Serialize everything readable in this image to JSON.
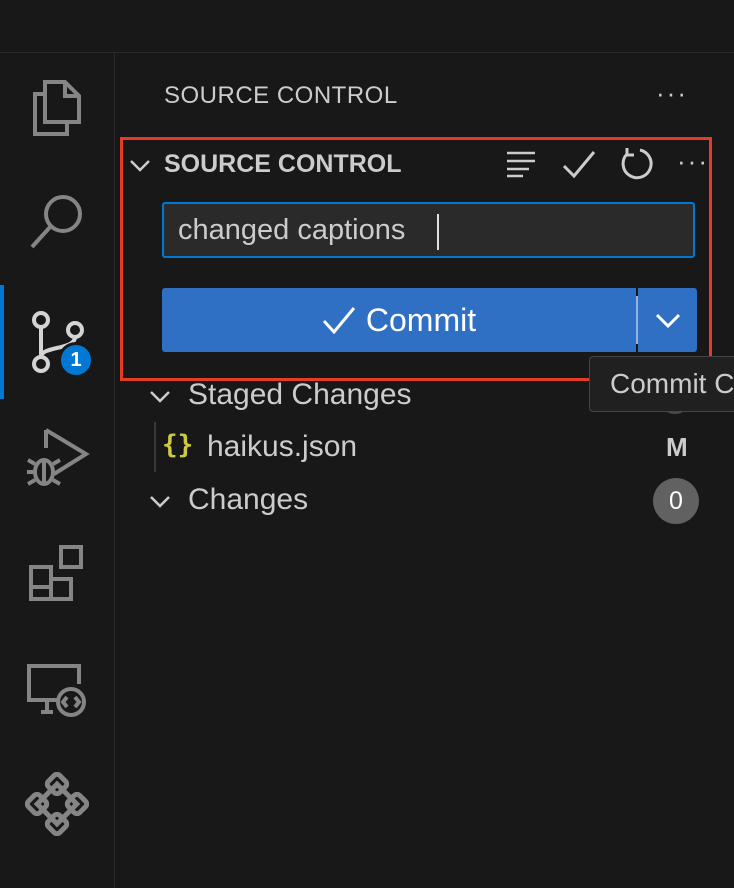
{
  "sidebar": {
    "title": "SOURCE CONTROL",
    "more_icon": "ellipsis-icon"
  },
  "activity_bar": {
    "items": [
      {
        "name": "explorer",
        "icon": "files-icon"
      },
      {
        "name": "search",
        "icon": "search-icon"
      },
      {
        "name": "source-control",
        "icon": "source-control-icon",
        "badge": "1",
        "active": true
      },
      {
        "name": "run-debug",
        "icon": "run-debug-icon"
      },
      {
        "name": "extensions",
        "icon": "extensions-icon"
      },
      {
        "name": "remote-explorer",
        "icon": "remote-explorer-icon"
      },
      {
        "name": "other",
        "icon": "diamond-grid-icon"
      }
    ]
  },
  "section": {
    "title": "SOURCE CONTROL",
    "actions": [
      "view-as-list-icon",
      "commit-check-icon",
      "refresh-icon",
      "ellipsis-icon"
    ]
  },
  "commit_message": {
    "value": "changed captions"
  },
  "commit_button": {
    "label": "Commit",
    "dropdown_icon": "chevron-down-icon"
  },
  "tooltip": {
    "text": "Commit C"
  },
  "staged": {
    "label": "Staged Changes",
    "files": [
      {
        "name": "haikus.json",
        "status": "M",
        "icon": "json-icon"
      }
    ]
  },
  "changes": {
    "label": "Changes",
    "count": "0"
  },
  "colors": {
    "accent": "#0078d4",
    "button": "#2f6fc4",
    "highlight": "#e43c25",
    "json_icon": "#cbcb41"
  }
}
